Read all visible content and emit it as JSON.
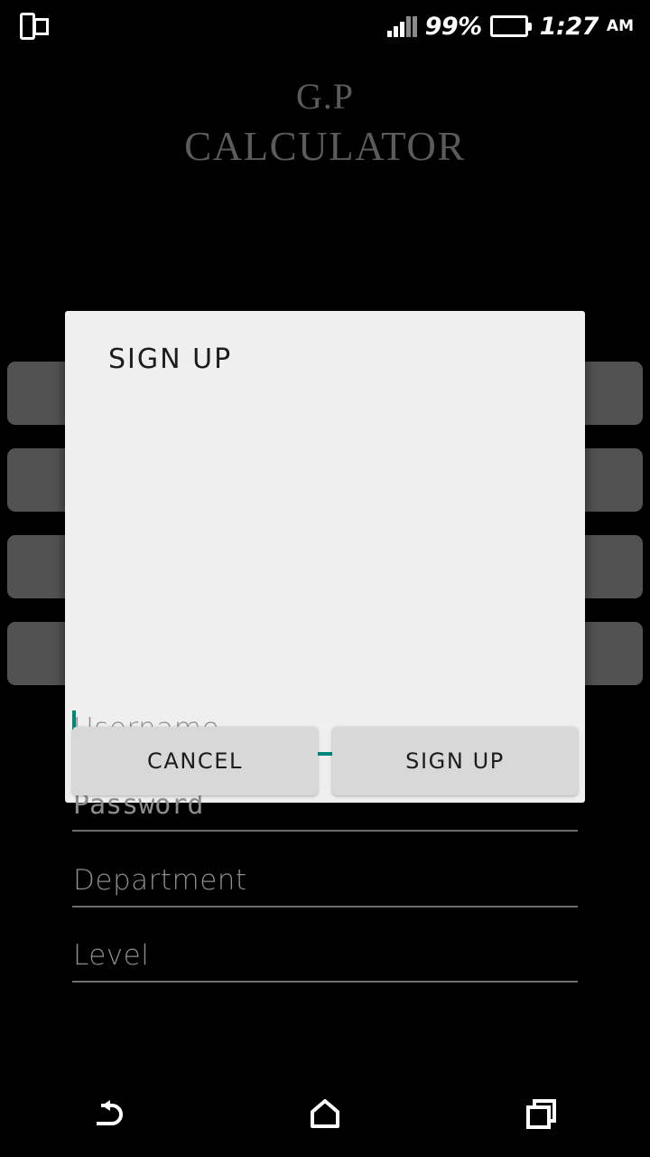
{
  "status_bar": {
    "cast_icon": "screen-mirror-icon",
    "signal_icon": "signal-bars-icon",
    "battery_percent": "99%",
    "battery_icon": "battery-full-icon",
    "time": "1:27",
    "ampm": "AM"
  },
  "app": {
    "title_line1": "G.P",
    "title_line2": "CALCULATOR",
    "title_color": "#5b5b5b"
  },
  "background_buttons": [
    {
      "label": ""
    },
    {
      "label": ""
    },
    {
      "label": ""
    },
    {
      "label": ""
    }
  ],
  "dialog": {
    "title": "SIGN UP",
    "accent_color": "#00897b",
    "background_color": "#efefef",
    "fields": [
      {
        "name": "username",
        "placeholder": "Username",
        "value": "",
        "focused": true,
        "underline_color": "#00897b"
      },
      {
        "name": "password",
        "placeholder": "Password",
        "value": "",
        "focused": false,
        "underline_color": "#6e6e6e"
      },
      {
        "name": "department",
        "placeholder": "Department",
        "value": "",
        "focused": false,
        "underline_color": "#6e6e6e"
      },
      {
        "name": "level",
        "placeholder": "Level",
        "value": "",
        "focused": false,
        "underline_color": "#6e6e6e"
      }
    ],
    "cancel_label": "CANCEL",
    "submit_label": "SIGN UP"
  },
  "nav_bar": {
    "back": "back-icon",
    "home": "home-icon",
    "recents": "recents-icon"
  }
}
